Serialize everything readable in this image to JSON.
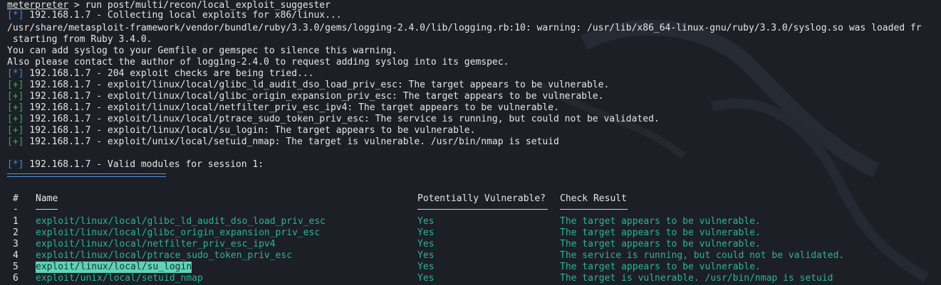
{
  "console": {
    "prompt": "meterpreter",
    "command": " > run post/multi/recon/local_exploit_suggester",
    "tag_info": "[*]",
    "tag_good": "[+]",
    "lines": [
      " 192.168.1.7 - Collecting local exploits for x86/linux...",
      "/usr/share/metasploit-framework/vendor/bundle/ruby/3.3.0/gems/logging-2.4.0/lib/logging.rb:10: warning: /usr/lib/x86_64-linux-gnu/ruby/3.3.0/syslog.so was loaded fr",
      " starting from Ruby 3.4.0.",
      "You can add syslog to your Gemfile or gemspec to silence this warning.",
      "Also please contact the author of logging-2.4.0 to request adding syslog into its gemspec.",
      " 192.168.1.7 - 204 exploit checks are being tried...",
      " 192.168.1.7 - exploit/linux/local/glibc_ld_audit_dso_load_priv_esc: The target appears to be vulnerable.",
      " 192.168.1.7 - exploit/linux/local/glibc_origin_expansion_priv_esc: The target appears to be vulnerable.",
      " 192.168.1.7 - exploit/linux/local/netfilter_priv_esc_ipv4: The target appears to be vulnerable.",
      " 192.168.1.7 - exploit/linux/local/ptrace_sudo_token_priv_esc: The service is running, but could not be validated.",
      " 192.168.1.7 - exploit/linux/local/su_login: The target appears to be vulnerable.",
      " 192.168.1.7 - exploit/unix/local/setuid_nmap: The target is vulnerable. /usr/bin/nmap is setuid",
      " 192.168.1.7 - Valid modules for session 1:"
    ]
  },
  "table": {
    "headers": [
      "#",
      "Name",
      "Potentially Vulnerable?",
      "Check Result"
    ],
    "dash": "-",
    "rows": [
      {
        "num": "1",
        "name": "exploit/linux/local/glibc_ld_audit_dso_load_priv_esc",
        "vuln": "Yes",
        "result": "The target appears to be vulnerable."
      },
      {
        "num": "2",
        "name": "exploit/linux/local/glibc_origin_expansion_priv_esc",
        "vuln": "Yes",
        "result": "The target appears to be vulnerable."
      },
      {
        "num": "3",
        "name": "exploit/linux/local/netfilter_priv_esc_ipv4",
        "vuln": "Yes",
        "result": "The target appears to be vulnerable."
      },
      {
        "num": "4",
        "name": "exploit/linux/local/ptrace_sudo_token_priv_esc",
        "vuln": "Yes",
        "result": "The service is running, but could not be validated."
      },
      {
        "num": "5",
        "name": "exploit/linux/local/su_login",
        "vuln": "Yes",
        "result": "The target appears to be vulnerable."
      },
      {
        "num": "6",
        "name": "exploit/unix/local/setuid_nmap",
        "vuln": "Yes",
        "result": "The target is vulnerable. /usr/bin/nmap is setuid"
      }
    ]
  },
  "colors": {
    "background": "#1c1f26",
    "text": "#e6e6e6",
    "info_tag": "#3b8eea",
    "good_tag": "#2fb34a",
    "table_teal": "#2eb398",
    "selection": "#5fd3b8"
  }
}
